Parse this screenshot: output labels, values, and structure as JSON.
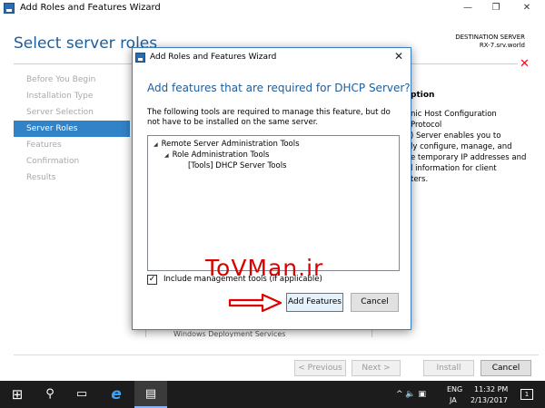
{
  "window": {
    "title": "Add Roles and Features Wizard",
    "minimize": "—",
    "restore": "❐",
    "close": "✕"
  },
  "header": {
    "page_title": "Select server roles",
    "destination_label": "DESTINATION SERVER",
    "destination_server": "RX-7.srv.world"
  },
  "nav": {
    "items": [
      {
        "label": "Before You Begin",
        "active": false
      },
      {
        "label": "Installation Type",
        "active": false
      },
      {
        "label": "Server Selection",
        "active": false
      },
      {
        "label": "Server Roles",
        "active": true
      },
      {
        "label": "Features",
        "active": false
      },
      {
        "label": "Confirmation",
        "active": false
      },
      {
        "label": "Results",
        "active": false
      }
    ]
  },
  "description": {
    "title": "ption",
    "lines": [
      "nic Host Configuration Protocol",
      ") Server enables you to",
      "ly configure, manage, and",
      "e temporary IP addresses and",
      "l information for client",
      "ters."
    ]
  },
  "behind_list_item": "Windows Deployment Services",
  "footer": {
    "previous": "< Previous",
    "next": "Next >",
    "install": "Install",
    "cancel": "Cancel"
  },
  "dialog": {
    "title": "Add Roles and Features Wizard",
    "close": "✕",
    "heading": "Add features that are required for DHCP Server?",
    "body": "The following tools are required to manage this feature, but do not have to be installed on the same server.",
    "tree": [
      {
        "label": "Remote Server Administration Tools",
        "level": 0,
        "arrow": "◢"
      },
      {
        "label": "Role Administration Tools",
        "level": 1,
        "arrow": "◢"
      },
      {
        "label": "[Tools] DHCP Server Tools",
        "level": 2,
        "arrow": ""
      }
    ],
    "include_tools_label": "Include management tools (if applicable)",
    "include_tools_checked": "✓",
    "add_features": "Add Features",
    "cancel": "Cancel"
  },
  "watermark": "ToVMan.ir",
  "taskbar": {
    "start_icon": "⊞",
    "search_icon": "⚲",
    "taskview_icon": "▭",
    "ie_icon": "e",
    "server_manager_icon": "▤",
    "tray_icons": "^ 🔈 ▣",
    "lang_top": "ENG",
    "lang_bottom": "JA",
    "time": "11:32 PM",
    "date": "2/13/2017",
    "notification_count": "1"
  },
  "colors": {
    "accent": "#3282c8",
    "heading_blue": "#1e5d9b",
    "watermark_red": "#d80000",
    "taskbar": "#1c1c1c"
  }
}
